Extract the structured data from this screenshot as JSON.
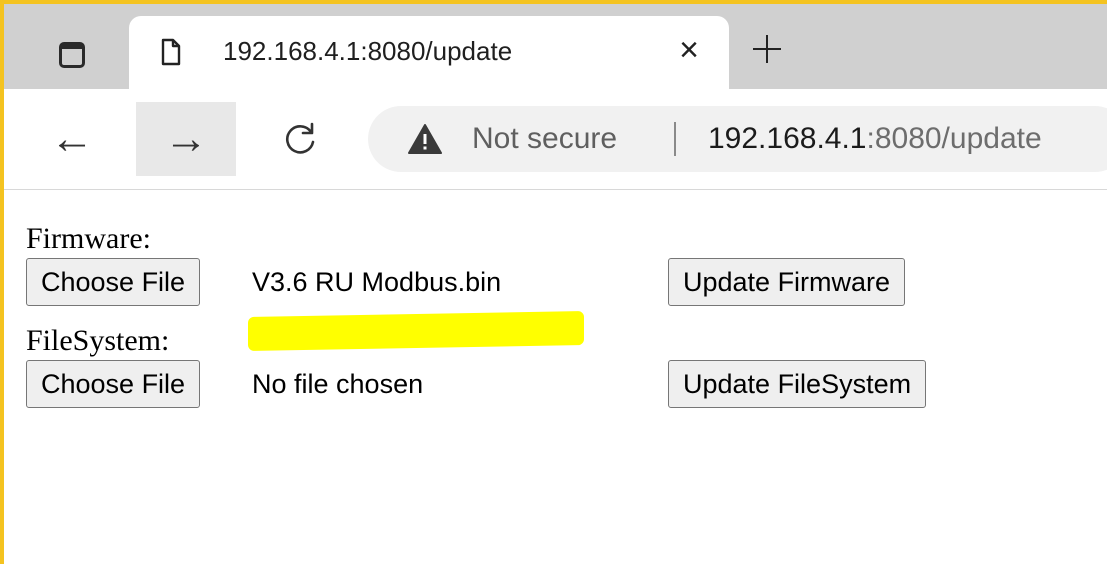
{
  "browser": {
    "tab": {
      "title": "192.168.4.1:8080/update",
      "close_glyph": "×"
    },
    "icons": {
      "tab_actions": "tab-actions-icon",
      "page": "page-icon",
      "close": "close-icon",
      "new_tab": "plus-icon",
      "back": "arrow-left-icon",
      "forward": "arrow-right-icon",
      "reload": "reload-icon",
      "security": "warning-triangle-icon"
    },
    "toolbar": {
      "back_glyph": "←",
      "forward_glyph": "→",
      "security_label": "Not secure",
      "url_host": "192.168.4.1",
      "url_rest": ":8080/update"
    },
    "colors": {
      "window_border": "#f4c320",
      "highlight": "#ffff00"
    }
  },
  "page": {
    "firmware": {
      "label": "Firmware:",
      "choose_label": "Choose File",
      "file_name": "V3.6 RU Modbus.bin",
      "update_label": "Update Firmware"
    },
    "filesystem": {
      "label": "FileSystem:",
      "choose_label": "Choose File",
      "file_name": "No file chosen",
      "update_label": "Update FileSystem"
    }
  }
}
